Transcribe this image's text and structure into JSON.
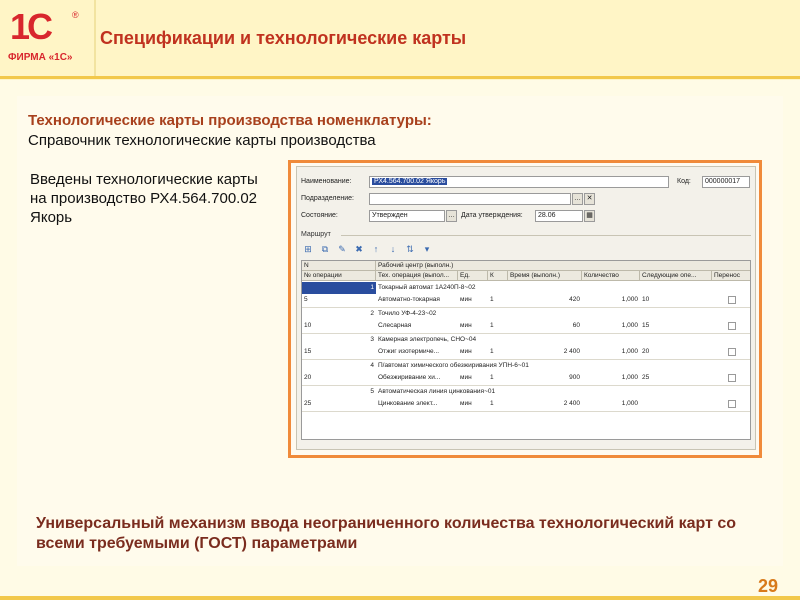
{
  "header": {
    "logo_mark": "1C",
    "logo_reg": "®",
    "logo_company": "ФИРМА «1С»",
    "title": "Спецификации и технологические карты"
  },
  "main": {
    "heading": "Технологические карты производства номенклатуры:",
    "subheading": "Справочник технологические карты производства",
    "intro": "Введены технологические карты на производство РХ4.564.700.02 Якорь",
    "bottom_text": "Универсальный механизм ввода неограниченного количества технологический карт со всеми требуемыми (ГОСТ) параметрами",
    "page_number": "29"
  },
  "form": {
    "name_label": "Наименование:",
    "name_value": "РХ4.564.700.02 Якорь",
    "code_label": "Код:",
    "code_value": "000000017",
    "division_label": "Подразделение:",
    "division_value": "",
    "state_label": "Состояние:",
    "state_value": "Утвержден",
    "approval_date_label": "Дата утверждения:",
    "approval_date_value": "28.06",
    "section_label": "Маршрут",
    "toolbar_icons": [
      "add-row-icon",
      "copy-row-icon",
      "edit-row-icon",
      "delete-row-icon",
      "move-up-icon",
      "move-down-icon",
      "sort-icon",
      "more-icon"
    ],
    "table": {
      "header_row1": [
        "N",
        "Рабочий центр (выполн.)"
      ],
      "header_row2": [
        "№ операции",
        "Тех. операция (выпол...",
        "Ед.",
        "К",
        "Время (выполн.)",
        "Количество",
        "Следующие опе...",
        "Перенос"
      ],
      "rows": [
        {
          "n": "1",
          "center": "Токарный автомат 1А240П-8~02",
          "op_no": "5",
          "operation": "Автоматно-токарная",
          "unit": "мин",
          "k": "1",
          "time": "420",
          "qty": "1,000",
          "next": "10",
          "transfer": false,
          "selected": true
        },
        {
          "n": "2",
          "center": "Точило УФ-4-23~02",
          "op_no": "10",
          "operation": "Слесарная",
          "unit": "мин",
          "k": "1",
          "time": "60",
          "qty": "1,000",
          "next": "15",
          "transfer": false,
          "selected": false
        },
        {
          "n": "3",
          "center": "Камерная электропечь, СНО~04",
          "op_no": "15",
          "operation": "Отжиг изотермиче...",
          "unit": "мин",
          "k": "1",
          "time": "2 400",
          "qty": "1,000",
          "next": "20",
          "transfer": false,
          "selected": false
        },
        {
          "n": "4",
          "center": "П/автомат химического обезжиривания УПН-6~01",
          "op_no": "20",
          "operation": "Обезжиривание хи...",
          "unit": "мин",
          "k": "1",
          "time": "900",
          "qty": "1,000",
          "next": "25",
          "transfer": false,
          "selected": false
        },
        {
          "n": "5",
          "center": "Автоматическая линия цинкования~01",
          "op_no": "25",
          "operation": "Цинкование элект...",
          "unit": "мин",
          "k": "1",
          "time": "2 400",
          "qty": "1,000",
          "next": "",
          "transfer": false,
          "selected": false
        }
      ]
    }
  },
  "colors": {
    "brand_red": "#d8262d",
    "title_red": "#c0321f",
    "heading_brown": "#a8401c",
    "frame_orange": "#f08a3a",
    "selection_blue": "#2a4d9e"
  }
}
